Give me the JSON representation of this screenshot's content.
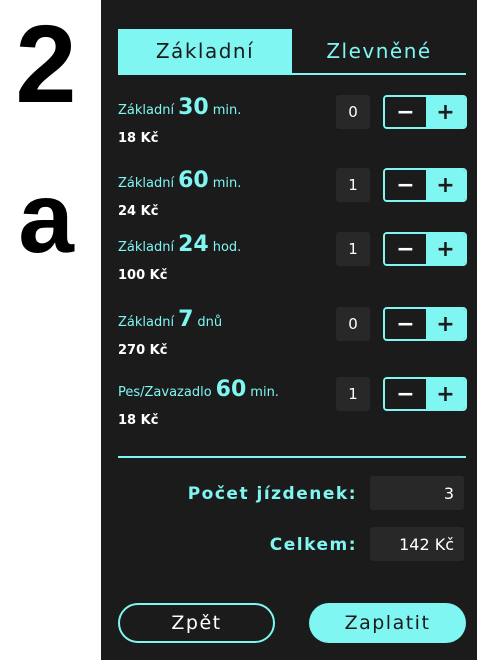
{
  "step": {
    "number": "2",
    "letter": "a"
  },
  "tabs": [
    {
      "label": "Základní",
      "active": true
    },
    {
      "label": "Zlevněné",
      "active": false
    }
  ],
  "tickets": [
    {
      "prefix": "Základní",
      "amount": "30",
      "unit": "min.",
      "price": "18 Kč",
      "quantity": "0"
    },
    {
      "prefix": "Základní",
      "amount": "60",
      "unit": "min.",
      "price": "24 Kč",
      "quantity": "1"
    },
    {
      "prefix": "Základní",
      "amount": "24",
      "unit": "hod.",
      "price": "100 Kč",
      "quantity": "1"
    },
    {
      "prefix": "Základní",
      "amount": "7",
      "unit": "dnů",
      "price": "270 Kč",
      "quantity": "0"
    },
    {
      "prefix": "Pes/Zavazadlo",
      "amount": "60",
      "unit": "min.",
      "price": "18 Kč",
      "quantity": "1"
    }
  ],
  "stepper": {
    "minus": "−",
    "plus": "+"
  },
  "summary": {
    "count_label": "Počet jízdenek:",
    "count_value": "3",
    "total_label": "Celkem:",
    "total_value": "142 Kč"
  },
  "buttons": {
    "back": "Zpět",
    "pay": "Zaplatit"
  },
  "colors": {
    "accent": "#7ff6f2",
    "panel": "#1b1b1b",
    "field": "#282828"
  }
}
